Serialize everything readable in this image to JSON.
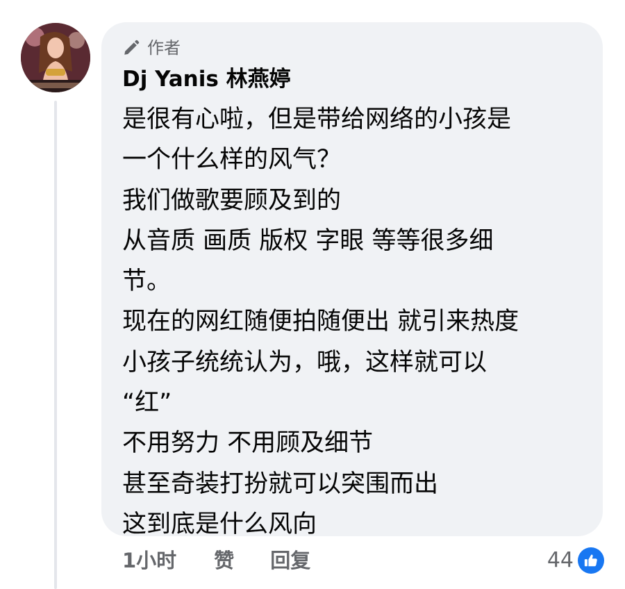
{
  "comment": {
    "author_badge": "作者",
    "commenter_name": "Dj Yanis 林燕婷",
    "lines": [
      "是很有心啦，但是带给网络的小孩是",
      "一个什么样的风气？",
      "我们做歌要顾及到的",
      "从音质 画质 版权 字眼 等等很多细",
      "节。",
      "现在的网红随便拍随便出 就引来热度",
      "小孩子统统认为，哦，这样就可以",
      "“红”",
      "不用努力 不用顾及细节",
      "甚至奇装打扮就可以突围而出",
      "这到底是什么风向"
    ]
  },
  "actions": {
    "time": "1小时",
    "like_label": "赞",
    "reply_label": "回复"
  },
  "reactions": {
    "count": "44",
    "icon": "thumbs-up-icon",
    "color": "#1877f2"
  },
  "colors": {
    "bubble": "#f0f2f5",
    "secondary_text": "#65676b",
    "thread_line": "#e4e6eb"
  }
}
